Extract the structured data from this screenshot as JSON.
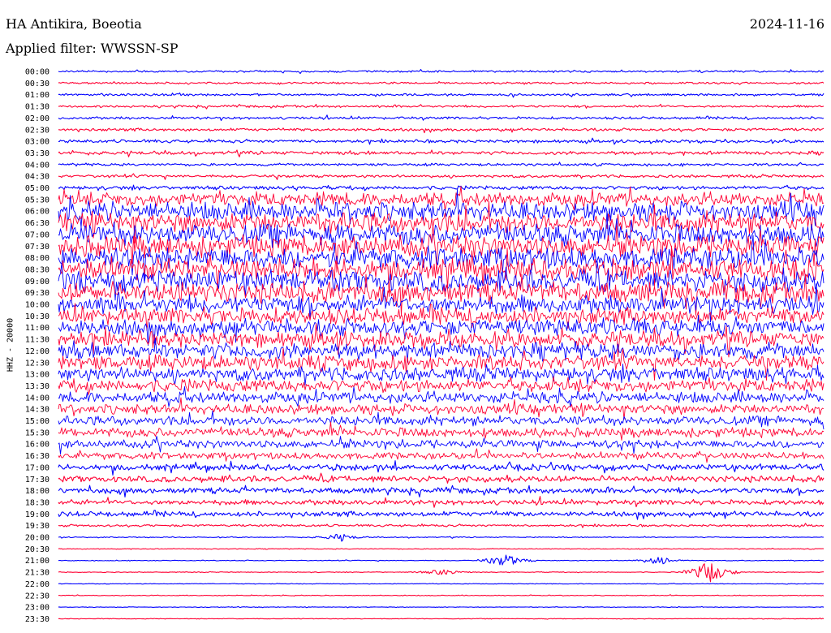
{
  "header": {
    "station": "HA Antikira, Boeotia",
    "date": "2024-11-16",
    "filter_prefix": "Applied filter: ",
    "filter": "WWSSN-SP"
  },
  "colors": {
    "even_hour": "#0000ff",
    "half_hour": "#ff0033",
    "text": "#000000"
  },
  "chart_data": {
    "type": "line",
    "title": "HA Antikira, Boeotia",
    "ylabel": "HHZ - 20000",
    "xlabel": "",
    "rows": [
      "00:00",
      "00:30",
      "01:00",
      "01:30",
      "02:00",
      "02:30",
      "03:00",
      "03:30",
      "04:00",
      "04:30",
      "05:00",
      "05:30",
      "06:00",
      "06:30",
      "07:00",
      "07:30",
      "08:00",
      "08:30",
      "09:00",
      "09:30",
      "10:00",
      "10:30",
      "11:00",
      "11:30",
      "12:00",
      "12:30",
      "13:00",
      "13:30",
      "14:00",
      "14:30",
      "15:00",
      "15:30",
      "16:00",
      "16:30",
      "17:00",
      "17:30",
      "18:00",
      "18:30",
      "19:00",
      "19:30",
      "20:00",
      "20:30",
      "21:00",
      "21:30",
      "22:00",
      "22:30",
      "23:00",
      "23:30"
    ],
    "relative_amplitude": [
      0.3,
      0.3,
      0.35,
      0.35,
      0.4,
      0.45,
      0.5,
      0.55,
      0.4,
      0.45,
      0.6,
      2.2,
      3.0,
      3.2,
      3.3,
      3.4,
      3.5,
      3.5,
      3.4,
      3.2,
      2.8,
      2.6,
      2.6,
      2.5,
      2.5,
      2.4,
      2.2,
      2.0,
      1.8,
      1.6,
      1.5,
      1.5,
      1.3,
      1.1,
      1.0,
      1.0,
      0.9,
      0.8,
      0.8,
      0.35,
      0.15,
      0.12,
      0.12,
      0.12,
      0.1,
      0.12,
      0.1,
      0.1
    ],
    "events": [
      {
        "row": "21:00",
        "minute": 17.5,
        "amplitude": 2.0
      },
      {
        "row": "21:00",
        "minute": 23.5,
        "amplitude": 1.2
      },
      {
        "row": "21:30",
        "minute": 25.5,
        "amplitude": 3.5
      },
      {
        "row": "21:30",
        "minute": 15.0,
        "amplitude": 0.8
      },
      {
        "row": "20:00",
        "minute": 11.0,
        "amplitude": 1.0
      }
    ],
    "grid": false,
    "legend": "none"
  }
}
